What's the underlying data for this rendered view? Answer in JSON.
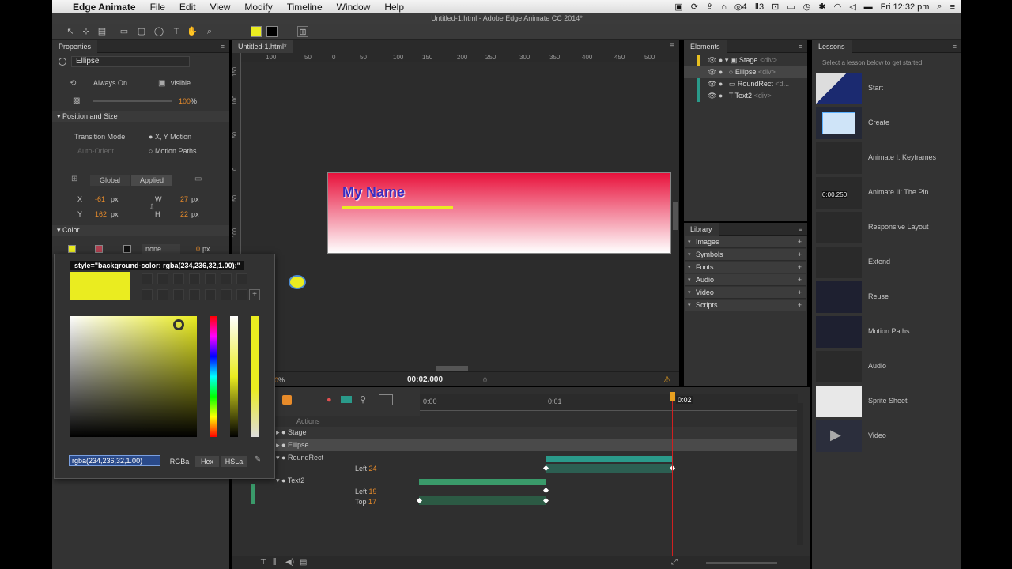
{
  "menubar": {
    "app_name": "Edge Animate",
    "items": [
      "File",
      "Edit",
      "View",
      "Modify",
      "Timeline",
      "Window",
      "Help"
    ],
    "status_num1": "4",
    "status_num2": "3",
    "clock": "Fri 12:32 pm"
  },
  "window_title": "Untitled-1.html - Adobe Edge Animate CC 2014*",
  "properties": {
    "tab": "Properties",
    "element_name": "Ellipse",
    "display_mode": "Always On",
    "overflow": "visible",
    "opacity": "100",
    "opacity_unit": "%",
    "position_size_header": "Position and Size",
    "transition_mode_label": "Transition Mode:",
    "transition_xy": "X, Y Motion",
    "auto_orient": "Auto-Orient",
    "motion_paths": "Motion Paths",
    "global_btn": "Global",
    "applied_btn": "Applied",
    "x_label": "X",
    "x_value": "-61",
    "y_label": "Y",
    "y_value": "162",
    "w_label": "W",
    "w_value": "27",
    "h_label": "H",
    "h_value": "22",
    "px": "px",
    "color_header": "Color",
    "border_style": "none",
    "border_width": "0",
    "border_unit": "px"
  },
  "picker": {
    "tooltip": "style=\"background-color: rgba(234,236,32,1.00);\"",
    "value": "rgba(234,236,32,1.00)",
    "modes": [
      "RGBa",
      "Hex",
      "HSLa"
    ],
    "current_color": "#eaec20"
  },
  "document_tab": "Untitled-1.html*",
  "ruler_ticks": [
    "100",
    "50",
    "0",
    "50",
    "100",
    "150",
    "200",
    "250",
    "300",
    "350",
    "400",
    "450",
    "500"
  ],
  "vruler_ticks": [
    "150",
    "100",
    "50",
    "0",
    "50",
    "100"
  ],
  "stage": {
    "headline": "My Name",
    "zoom_value": "0",
    "zoom_unit": "%",
    "playhead_time": "00:02.000",
    "playhead_small": "0"
  },
  "elements": {
    "tab": "Elements",
    "rows": [
      {
        "name": "Stage",
        "tag": "<div>"
      },
      {
        "name": "Ellipse",
        "tag": "<div>"
      },
      {
        "name": "RoundRect",
        "tag": "<d..."
      },
      {
        "name": "Text2",
        "tag": "<div>"
      }
    ]
  },
  "library": {
    "tab": "Library",
    "items": [
      "Images",
      "Symbols",
      "Fonts",
      "Audio",
      "Video",
      "Scripts"
    ]
  },
  "lessons": {
    "tab": "Lessons",
    "subtitle": "Select a lesson below to get started",
    "items": [
      "Start",
      "Create",
      "Animate I: Keyframes",
      "Animate II: The Pin",
      "Responsive Layout",
      "Extend",
      "Reuse",
      "Motion Paths",
      "Audio",
      "Sprite Sheet",
      "Video"
    ],
    "pin_time": "0:00.250"
  },
  "timeline": {
    "actions_label": "Actions",
    "rows": [
      {
        "name": "Stage"
      },
      {
        "name": "Ellipse"
      },
      {
        "name": "RoundRect"
      },
      {
        "prop": "Left",
        "value": "24"
      },
      {
        "name": "Text2"
      },
      {
        "prop": "Left",
        "value": "19"
      },
      {
        "prop": "Top",
        "value": "17"
      }
    ],
    "time_marks": [
      "0:00",
      "0:01",
      "0:02"
    ]
  },
  "colors": {
    "accent_orange": "#e88b2a",
    "track_teal": "#2a9a8a",
    "track_green": "#3a9a6a",
    "headline_text": "#3b2cc0",
    "underline": "#eaec20",
    "playhead": "#d02020"
  }
}
